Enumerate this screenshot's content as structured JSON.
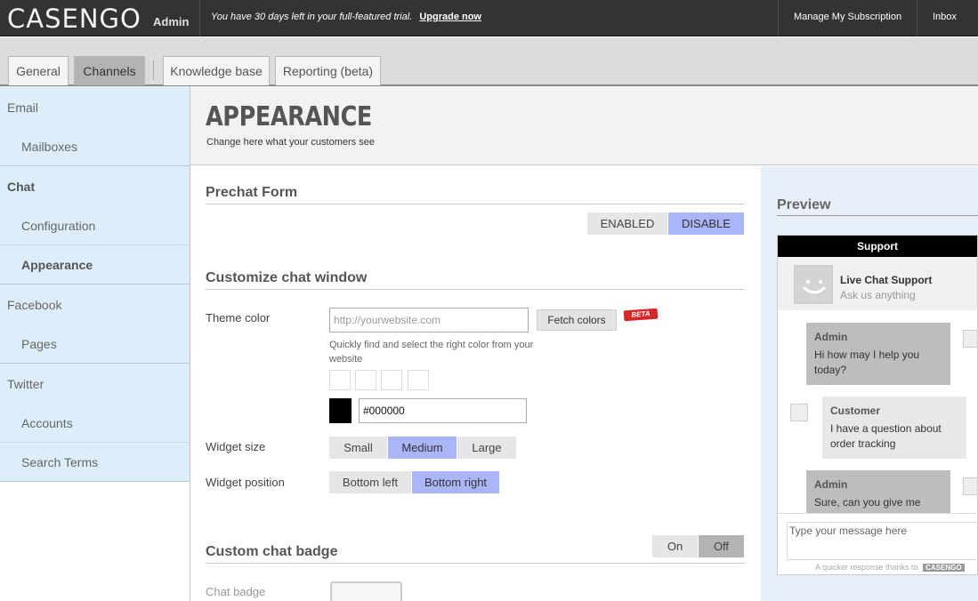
{
  "topbar": {
    "logo": "CASENGO",
    "logo_sub": "Admin",
    "trial_text": "You have 30 days left in your full-featured trial.",
    "upgrade_link": "Upgrade now",
    "manage_subscription": "Manage My Subscription",
    "inbox": "Inbox"
  },
  "tabs": [
    {
      "label": "General",
      "active": false
    },
    {
      "label": "Channels",
      "active": true
    },
    {
      "label": "Knowledge base",
      "active": false
    },
    {
      "label": "Reporting (beta)",
      "active": false
    }
  ],
  "sidebar": {
    "items": [
      {
        "label": "Email",
        "level": "top"
      },
      {
        "label": "Mailboxes",
        "level": "sub"
      },
      {
        "label": "Chat",
        "level": "top",
        "selected": true
      },
      {
        "label": "Configuration",
        "level": "sub"
      },
      {
        "label": "Appearance",
        "level": "sub",
        "selected": true
      },
      {
        "label": "Facebook",
        "level": "top"
      },
      {
        "label": "Pages",
        "level": "sub"
      },
      {
        "label": "Twitter",
        "level": "top"
      },
      {
        "label": "Accounts",
        "level": "sub"
      },
      {
        "label": "Search Terms",
        "level": "sub"
      }
    ]
  },
  "header": {
    "title": "APPEARANCE",
    "subtitle": "Change here what your customers see"
  },
  "prechat": {
    "title": "Prechat Form",
    "enabled_label": "ENABLED",
    "disable_label": "DISABLE",
    "selected": "DISABLE"
  },
  "customize": {
    "title": "Customize chat window",
    "theme_color_label": "Theme color",
    "website_placeholder": "http://yourwebsite.com",
    "fetch_button": "Fetch colors",
    "beta_badge": "BETA",
    "help_text": "Quickly find and select the right color from your website",
    "color_value": "#000000",
    "color_swatch": "#000000",
    "widget_size_label": "Widget size",
    "size_options": [
      "Small",
      "Medium",
      "Large"
    ],
    "size_selected": "Medium",
    "widget_position_label": "Widget position",
    "position_options": [
      "Bottom left",
      "Bottom right"
    ],
    "position_selected": "Bottom right"
  },
  "badge": {
    "title": "Custom chat badge",
    "on_label": "On",
    "off_label": "Off",
    "selected": "Off",
    "chat_badge_label": "Chat badge"
  },
  "preview": {
    "title": "Preview",
    "header": "Support",
    "support_name": "Live Chat Support",
    "support_sub": "Ask us anything",
    "messages": [
      {
        "who": "Admin",
        "text": "Hi how may I help you today?"
      },
      {
        "who": "Customer",
        "text": "I have a question about order tracking"
      },
      {
        "who": "Admin",
        "text": "Sure, can you give me your"
      }
    ],
    "input_placeholder": "Type your message here",
    "footer_text": "A quicker response thanks to",
    "footer_brand": "CASENGO"
  },
  "colors": {
    "accent": "#aab6f7",
    "sidebar_bg": "#ddeefa",
    "topbar_bg": "#333333"
  }
}
